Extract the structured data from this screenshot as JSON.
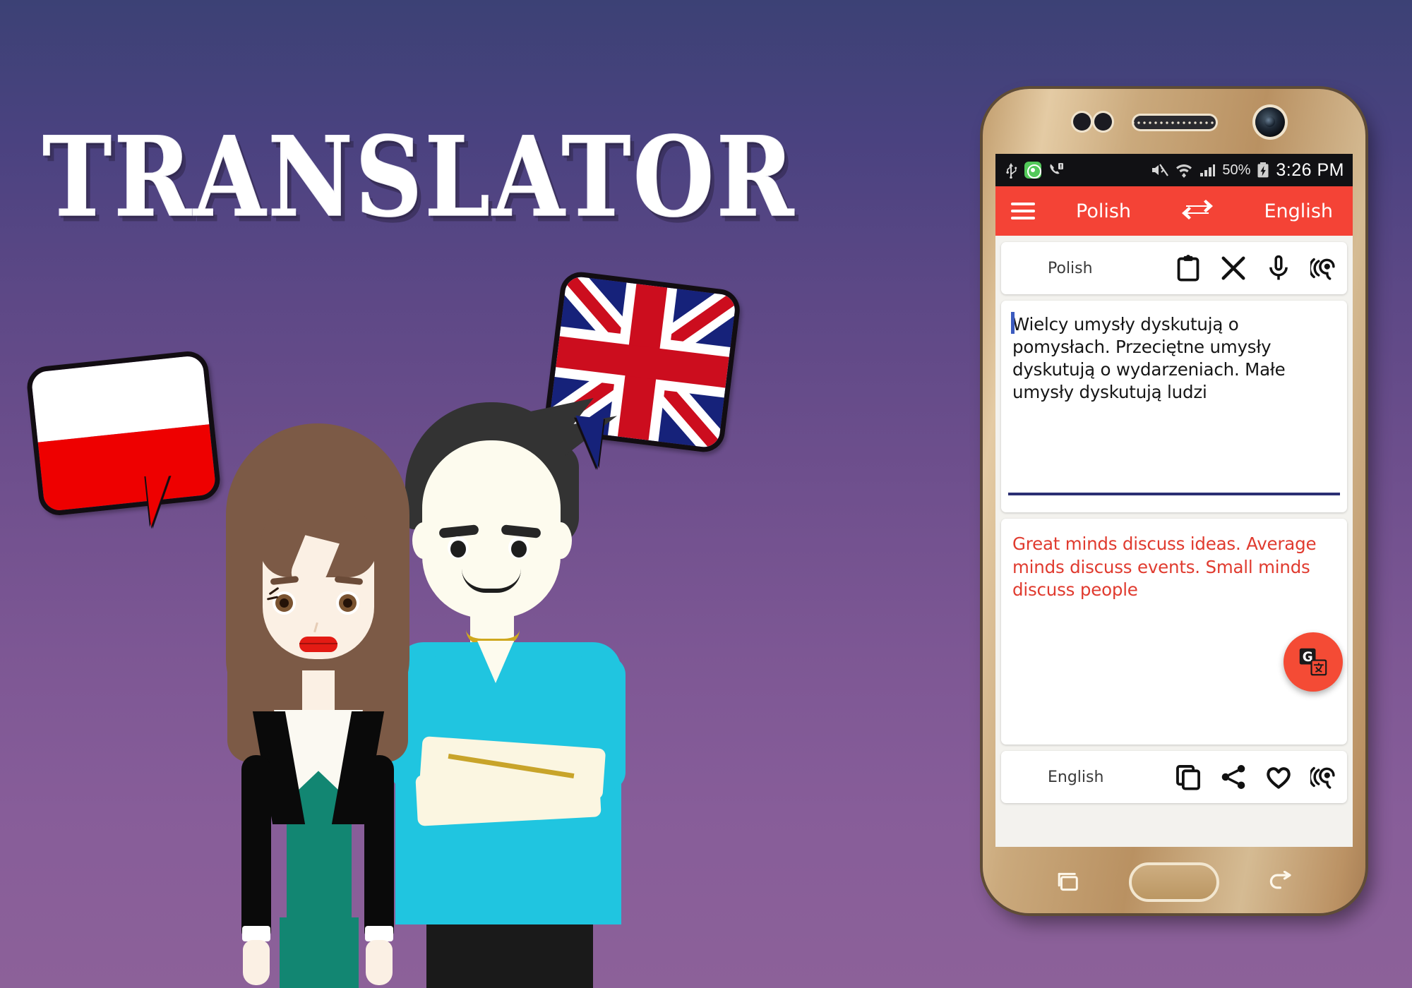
{
  "poster": {
    "title": "TRANSLATOR",
    "background_top_color": "#3c4175",
    "background_bottom_color": "#8c6199",
    "flags": {
      "source_bubble": "poland-flag-speech-bubble",
      "target_bubble": "united-kingdom-flag-speech-bubble"
    },
    "characters": {
      "woman": "woman-character",
      "man": "man-character"
    }
  },
  "phone": {
    "body_color": "#c9a87a",
    "status_bar": {
      "left_icons": [
        "usb-icon",
        "screen-recorder-icon",
        "missed-call-icon"
      ],
      "right_icons": [
        "mute-icon",
        "wifi-icon",
        "cellular-signal-icon"
      ],
      "battery_percent": "50%",
      "battery_icon": "battery-charging-icon",
      "time": "3:26 PM"
    },
    "nav_bar": {
      "recents": "recents-icon",
      "home": "home-button",
      "back": "back-icon"
    }
  },
  "app": {
    "accent_color": "#f44336",
    "menu_icon": "hamburger-menu-icon",
    "source_language": "Polish",
    "swap_icon": "swap-languages-icon",
    "target_language": "English",
    "input_panel": {
      "label": "Polish",
      "icons": [
        "paste-icon",
        "clear-icon",
        "microphone-icon",
        "listen-icon"
      ],
      "text": "Wielcy umysły dyskutują o pomysłach. Przeciętne umysły dyskutują o wydarzeniach. Małe umysły dyskutują ludzi",
      "underline_color": "#2b2f73",
      "caret_color": "#3b5bbf"
    },
    "fab": {
      "icon": "google-translate-icon",
      "color": "#f44b35"
    },
    "output_panel": {
      "text": "Great minds discuss ideas. Average minds discuss events. Small minds discuss people",
      "text_color": "#e03b2f",
      "label": "English",
      "icons": [
        "copy-icon",
        "share-icon",
        "favorite-icon",
        "listen-icon"
      ]
    }
  }
}
